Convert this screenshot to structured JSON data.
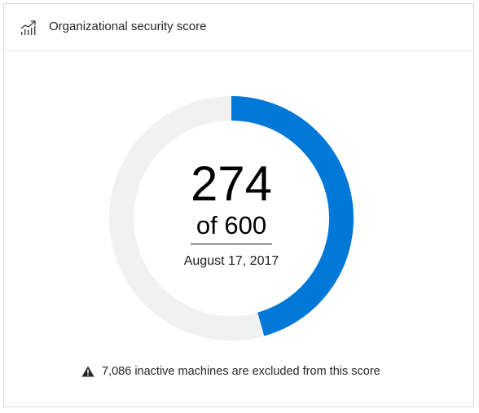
{
  "card": {
    "title": "Organizational security score",
    "icon": "trending-chart-icon"
  },
  "score": {
    "value": 274,
    "value_label": "274",
    "max_label": "of 600",
    "max": 600,
    "date": "August 17, 2017"
  },
  "colors": {
    "progress": "#0078d7",
    "track": "#f0f1f1",
    "divider": "#e1e1e1"
  },
  "footer": {
    "icon": "warning-icon",
    "text": "7,086 inactive machines are excluded from this score"
  }
}
